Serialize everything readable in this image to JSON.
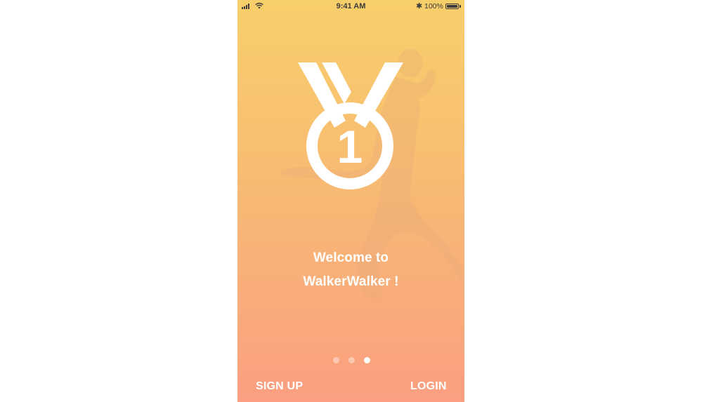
{
  "status_bar": {
    "time": "9:41 AM",
    "bluetooth": "✱",
    "battery_percent": "100%",
    "battery_level": 1.0,
    "signal_icon": "cellular-signal-icon",
    "wifi_icon": "wifi-icon"
  },
  "logo": {
    "icon": "medal-icon",
    "number": "1"
  },
  "welcome": {
    "line1": "Welcome to",
    "line2": "WalkerWalker !"
  },
  "pagination": {
    "total": 3,
    "active_index": 2
  },
  "actions": {
    "signup_label": "SIGN UP",
    "login_label": "LOGIN"
  },
  "colors": {
    "gradient_top": "#f7cf6a",
    "gradient_bottom": "#fa9f82",
    "text": "#ffffff"
  }
}
